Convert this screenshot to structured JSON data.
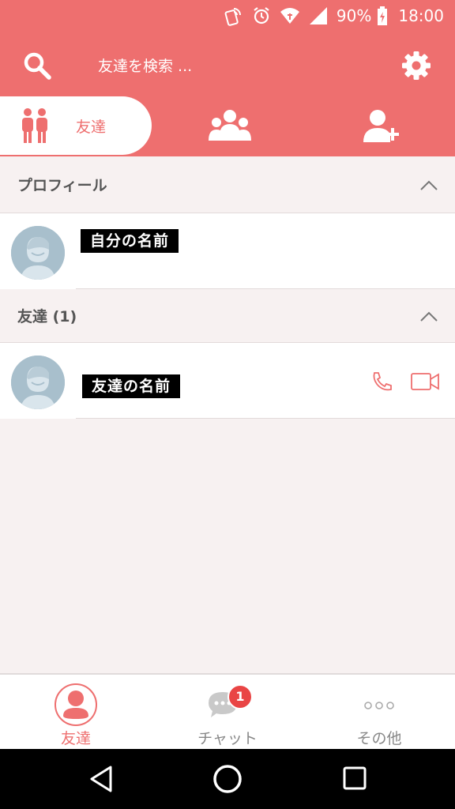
{
  "status_bar": {
    "battery": "90%",
    "time": "18:00"
  },
  "header": {
    "search": {
      "placeholder": "友達を検索 ..."
    },
    "tabs": {
      "friends": "友達"
    }
  },
  "profile_section": {
    "title": "プロフィール",
    "my_name": "自分の名前"
  },
  "friends_section": {
    "title": "友達 (1)",
    "friend_name": "友達の名前"
  },
  "bottom_nav": {
    "friends": "友達",
    "chat": "チャット",
    "chat_badge": "1",
    "more": "その他"
  },
  "colors": {
    "accent": "#ee6f6f",
    "badge": "#e94545",
    "background": "#f7f1f1"
  }
}
